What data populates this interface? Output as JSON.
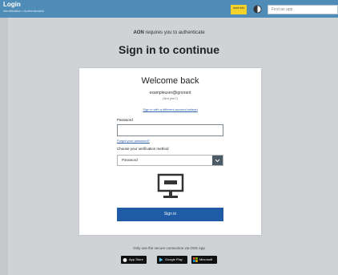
{
  "header": {
    "title": "Login",
    "subtitle": "Identification • Authentication",
    "badge": "more info",
    "search_placeholder": "Find an app"
  },
  "page": {
    "requires_brand": "AON",
    "requires_text": " requires you to authenticate",
    "heading": "Sign in to continue"
  },
  "card": {
    "welcome": "Welcome back",
    "username": "exampleuser@ignorant",
    "username_sub": "(Not you?)",
    "alt_link": "Sign in with a different account instead",
    "password_label": "Password",
    "forgot_link": "Forgot your password?",
    "method_label": "Choose your verification method",
    "method_value": "Password",
    "submit_label": "Sign in"
  },
  "footer": {
    "text": "Only use the secure connection via OSS App",
    "stores": [
      "App Store",
      "Google Play",
      "Microsoft"
    ]
  },
  "colors": {
    "header_bg": "#4f8db8",
    "accent": "#1f5ba6",
    "badge": "#f2d22b"
  }
}
